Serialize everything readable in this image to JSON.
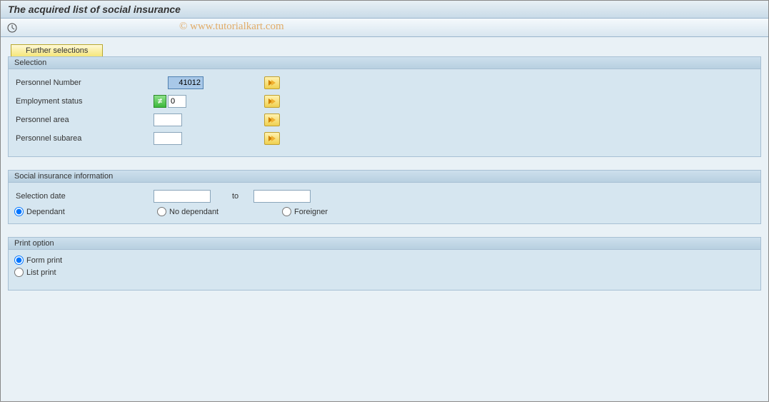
{
  "title": "The acquired list of social insurance",
  "watermark": "© www.tutorialkart.com",
  "further_selections_label": "Further selections",
  "selection_group": {
    "title": "Selection",
    "personnel_number_label": "Personnel Number",
    "personnel_number_value": "41012",
    "employment_status_label": "Employment status",
    "employment_status_value": "0",
    "personnel_area_label": "Personnel area",
    "personnel_area_value": "",
    "personnel_subarea_label": "Personnel subarea",
    "personnel_subarea_value": ""
  },
  "social_group": {
    "title": "Social insurance information",
    "selection_date_label": "Selection date",
    "selection_date_from": "",
    "to_label": "to",
    "selection_date_to": "",
    "radio_dependant": "Dependant",
    "radio_no_dependant": "No dependant",
    "radio_foreigner": "Foreigner"
  },
  "print_group": {
    "title": "Print option",
    "radio_form_print": "Form print",
    "radio_list_print": "List print"
  }
}
